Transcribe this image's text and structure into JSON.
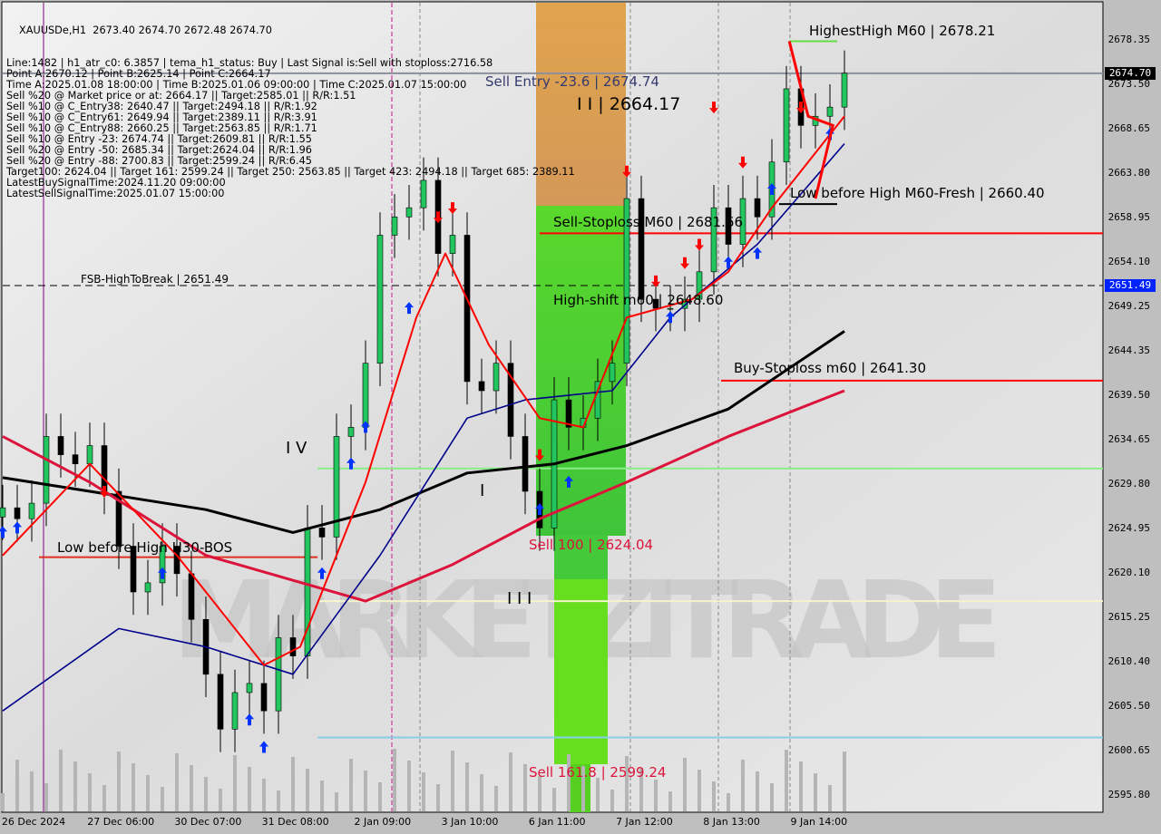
{
  "header": {
    "symbol_line": "XAUUSDe,H1  2673.40 2674.70 2672.48 2674.70",
    "lines": [
      "Line:1482 | h1_atr_c0: 6.3857 | tema_h1_status: Buy | Last Signal is:Sell with stoploss:2716.58",
      "Point A:2670.12 | Point B:2625.14 | Point C:2664.17",
      "Time A:2025.01.08 18:00:00 | Time B:2025.01.06 09:00:00 | Time C:2025.01.07 15:00:00",
      "Sell %20 @ Market price or at: 2664.17 || Target:2585.01 || R/R:1.51",
      "Sell %10 @ C_Entry38: 2640.47 || Target:2494.18 || R/R:1.92",
      "Sell %10 @ C_Entry61: 2649.94 || Target:2389.11 || R/R:3.91",
      "Sell %10 @ C_Entry88: 2660.25 || Target:2563.85 || R/R:1.71",
      "Sell %10 @ Entry -23: 2674.74 || Target:2609.81 || R/R:1.55",
      "Sell %20 @ Entry -50: 2685.34 || Target:2624.04 || R/R:1.96",
      "Sell %20 @ Entry -88: 2700.83 || Target:2599.24 || R/R:6.45",
      "Target100: 2624.04 || Target 161: 2599.24 || Target 250: 2563.85 || Target 423: 2494.18 || Target 685: 2389.11",
      "LatestBuySignalTime:2024.11.20 09:00:00",
      "LatestSellSignalTime:2025.01.07 15:00:00"
    ]
  },
  "annotations": {
    "sell_entry": "Sell Entry -23.6 | 2674.74",
    "point_c": "I I | 2664.17",
    "highest_high": "HighestHigh   M60 | 2678.21",
    "low_before_high_m60": "Low before High   M60-Fresh | 2660.40",
    "sell_stoploss": "Sell-Stoploss M60 | 2681.66",
    "fsb": "FSB-HighToBreak | 2651.49",
    "high_shift": "High-shift m60 | 2648.60",
    "buy_stoploss": "Buy-Stoploss m60 | 2641.30",
    "wave_iv": "I V",
    "wave_i": "I",
    "wave_iii": "I I I",
    "low_before_high_h30": "Low before High   H30-BOS",
    "sell_100": "Sell 100 | 2624.04",
    "sell_161": "Sell 161.8 | 2599.24",
    "watermark": "MARKETZITRADE"
  },
  "colors": {
    "bull": "#22c55e",
    "bear": "#000000",
    "ma_slow": "#000000",
    "ma_mid": "#dc143c",
    "ma_blue": "#00008b",
    "ma_fast": "#ff0000",
    "buy_arrow": "#0033ff",
    "sell_arrow": "#ff0000",
    "zone_sell": "#d89a52",
    "zone_target": "#55d42a"
  },
  "chart_data": {
    "type": "candlestick",
    "title": "XAUUSDe,H1",
    "ylim": [
      2593.5,
      2682.5
    ],
    "y_ticks": [
      "2678.35",
      "2673.50",
      "2668.65",
      "2663.80",
      "2658.95",
      "2654.10",
      "2649.25",
      "2644.35",
      "2639.50",
      "2634.65",
      "2629.80",
      "2624.95",
      "2620.10",
      "2615.25",
      "2610.40",
      "2605.50",
      "2600.65",
      "2595.80"
    ],
    "x_ticks": [
      "26 Dec 2024",
      "27 Dec 06:00",
      "30 Dec 07:00",
      "31 Dec 08:00",
      "2 Jan 09:00",
      "3 Jan 10:00",
      "6 Jan 11:00",
      "7 Jan 12:00",
      "8 Jan 13:00",
      "9 Jan 14:00"
    ],
    "current_price": "2674.70",
    "fsb_price": "2651.49",
    "close": [
      2627.2,
      2626,
      2627.7,
      2635,
      2633,
      2632,
      2634,
      2629,
      2623,
      2618,
      2619,
      2623,
      2620,
      2615,
      2609,
      2603,
      2607,
      2608,
      2605,
      2613,
      2611,
      2625,
      2624,
      2635,
      2636,
      2643,
      2657,
      2659,
      2660,
      2663,
      2655,
      2657,
      2641,
      2640,
      2643,
      2635,
      2629,
      2625,
      2639,
      2636,
      2637,
      2641,
      2643,
      2661,
      2650,
      2649,
      2649,
      2650,
      2653,
      2660,
      2656,
      2661,
      2659,
      2665,
      2673,
      2669,
      2670,
      2671,
      2674.7
    ],
    "ma_slow": [
      [
        0,
        2630.5
      ],
      [
        14,
        2627
      ],
      [
        20,
        2624.5
      ],
      [
        26,
        2627
      ],
      [
        32,
        2631
      ],
      [
        38,
        2632
      ],
      [
        43,
        2634
      ],
      [
        50,
        2638
      ],
      [
        58,
        2646.5
      ]
    ],
    "ma_mid": [
      [
        0,
        2635
      ],
      [
        6,
        2630
      ],
      [
        14,
        2622
      ],
      [
        25,
        2617
      ],
      [
        31,
        2621
      ],
      [
        37,
        2626
      ],
      [
        43,
        2630
      ],
      [
        50,
        2635
      ],
      [
        58,
        2640
      ]
    ],
    "ma_blue": [
      [
        0,
        2605
      ],
      [
        8,
        2614
      ],
      [
        14,
        2612
      ],
      [
        20,
        2609
      ],
      [
        26,
        2622
      ],
      [
        32,
        2637
      ],
      [
        36,
        2639
      ],
      [
        42,
        2640
      ],
      [
        46,
        2648
      ],
      [
        52,
        2656
      ],
      [
        58,
        2667
      ]
    ],
    "ma_fast": [
      [
        0,
        2622
      ],
      [
        6,
        2632
      ],
      [
        12,
        2622
      ],
      [
        18,
        2610
      ],
      [
        20.5,
        2612
      ],
      [
        25,
        2630
      ],
      [
        28.5,
        2648
      ],
      [
        30.5,
        2655
      ],
      [
        33.5,
        2645
      ],
      [
        37,
        2637
      ],
      [
        40,
        2636
      ],
      [
        43,
        2648
      ],
      [
        47.5,
        2650
      ],
      [
        50,
        2653
      ],
      [
        53,
        2660
      ],
      [
        58,
        2670
      ]
    ],
    "levels": [
      {
        "price": 2674.7,
        "color": "#8a8f99",
        "style": "solid"
      },
      {
        "price": 2651.49,
        "color": "#000000",
        "style": "dashed"
      },
      {
        "price": 2657.2,
        "color": "#ff0000",
        "style": "solid",
        "from": 37
      },
      {
        "price": 2641.1,
        "color": "#ff0000",
        "style": "solid",
        "from": 49.5
      },
      {
        "price": 2631.5,
        "color": "#88ee88",
        "style": "solid",
        "from": 21.7
      },
      {
        "price": 2617.0,
        "color": "#f5f5cc",
        "style": "solid",
        "from": 21.7
      },
      {
        "price": 2602.1,
        "color": "#87ceeb",
        "style": "solid",
        "from": 21.7
      },
      {
        "price": 2678.2,
        "color": "#66dd44",
        "style": "solid",
        "from": 54.2,
        "to": 57.5
      },
      {
        "price": 2660.4,
        "color": "#000000",
        "style": "solid",
        "from": 53.5,
        "to": 57.5
      },
      {
        "price": 2621.8,
        "color": "#e03020",
        "style": "solid",
        "from": 2.5,
        "to": 21.7
      }
    ],
    "signals": [
      {
        "i": 0,
        "p": 2624.5,
        "t": "buy"
      },
      {
        "i": 1,
        "p": 2625,
        "t": "buy"
      },
      {
        "i": 7,
        "p": 2629,
        "t": "sell"
      },
      {
        "i": 11,
        "p": 2620,
        "t": "buy"
      },
      {
        "i": 17,
        "p": 2604,
        "t": "buy"
      },
      {
        "i": 18,
        "p": 2601,
        "t": "buy"
      },
      {
        "i": 22,
        "p": 2620,
        "t": "buy"
      },
      {
        "i": 24,
        "p": 2632,
        "t": "buy"
      },
      {
        "i": 25,
        "p": 2636,
        "t": "buy"
      },
      {
        "i": 28,
        "p": 2649,
        "t": "buy"
      },
      {
        "i": 30,
        "p": 2659,
        "t": "sell"
      },
      {
        "i": 31,
        "p": 2660,
        "t": "sell"
      },
      {
        "i": 37,
        "p": 2627,
        "t": "buy"
      },
      {
        "i": 37,
        "p": 2633,
        "t": "sell"
      },
      {
        "i": 39,
        "p": 2630,
        "t": "buy"
      },
      {
        "i": 43,
        "p": 2664,
        "t": "sell"
      },
      {
        "i": 45,
        "p": 2652,
        "t": "sell"
      },
      {
        "i": 46,
        "p": 2648,
        "t": "buy"
      },
      {
        "i": 47,
        "p": 2654,
        "t": "sell"
      },
      {
        "i": 48,
        "p": 2656,
        "t": "sell"
      },
      {
        "i": 49,
        "p": 2671,
        "t": "sell"
      },
      {
        "i": 50,
        "p": 2654,
        "t": "buy"
      },
      {
        "i": 51,
        "p": 2665,
        "t": "sell"
      },
      {
        "i": 52,
        "p": 2655,
        "t": "buy"
      },
      {
        "i": 53,
        "p": 2662,
        "t": "buy"
      },
      {
        "i": 55,
        "p": 2671,
        "t": "sell"
      },
      {
        "i": 57,
        "p": 2668,
        "t": "buy"
      }
    ]
  }
}
